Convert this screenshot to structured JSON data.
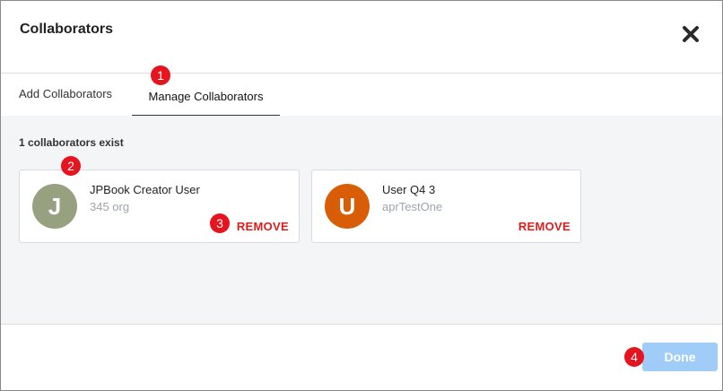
{
  "dialog": {
    "title": "Collaborators",
    "close_icon": "close-icon"
  },
  "tabs": [
    {
      "label": "Add Collaborators",
      "active": false
    },
    {
      "label": "Manage Collaborators",
      "active": true
    }
  ],
  "content": {
    "count_text": "1 collaborators exist",
    "collaborators": [
      {
        "initial": "J",
        "name": "JPBook Creator User",
        "org": "345 org",
        "avatar_color": "#98a17f",
        "remove_label": "REMOVE"
      },
      {
        "initial": "U",
        "name": "User Q4 3",
        "org": "aprTestOne",
        "avatar_color": "#d95d06",
        "remove_label": "REMOVE"
      }
    ]
  },
  "footer": {
    "done_label": "Done"
  },
  "annotations": [
    "1",
    "2",
    "3",
    "4"
  ],
  "colors": {
    "remove": "#e01d1d",
    "done_bg": "#9fcdf7",
    "badge": "#e5141e"
  }
}
